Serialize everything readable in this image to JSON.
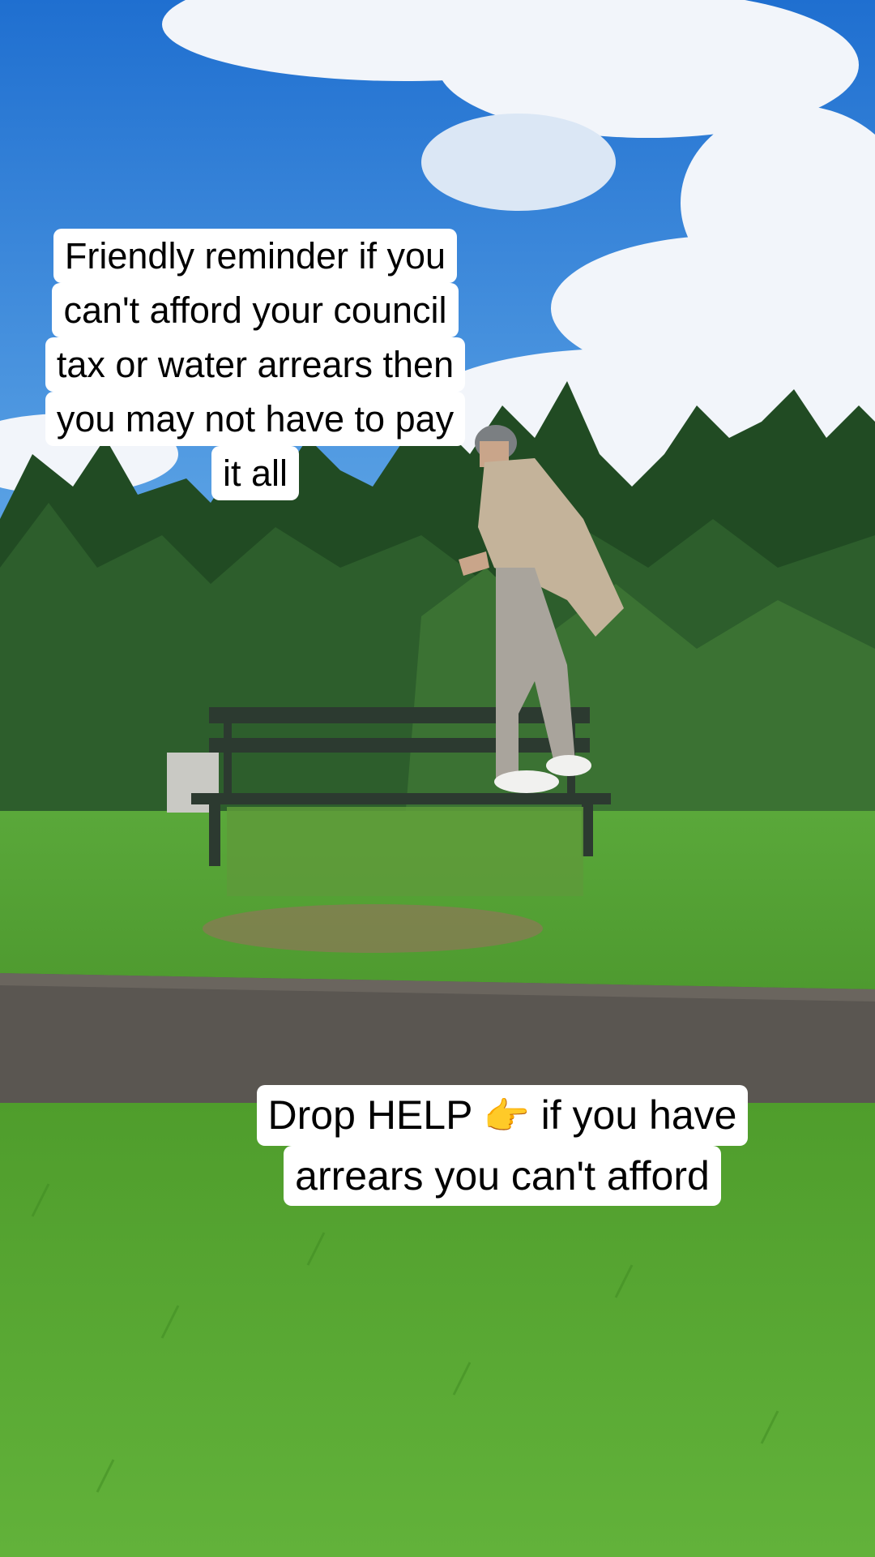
{
  "captions": {
    "top": {
      "lines": [
        "Friendly reminder if you",
        "can't afford your council",
        "tax or water arrears then",
        "you may not have to pay",
        "it all"
      ]
    },
    "bottom": {
      "line1_before": "Drop HELP",
      "emoji": "👉",
      "line1_after": "if you have",
      "line2": "arrears you can't afford"
    }
  },
  "scene": {
    "colors": {
      "sky": "#2f7fd6",
      "cloud": "#f4f7fb",
      "trees": "#1f4a22",
      "grass": "#5aa532",
      "path": "#5b5651",
      "bench": "#2f3e33"
    }
  }
}
